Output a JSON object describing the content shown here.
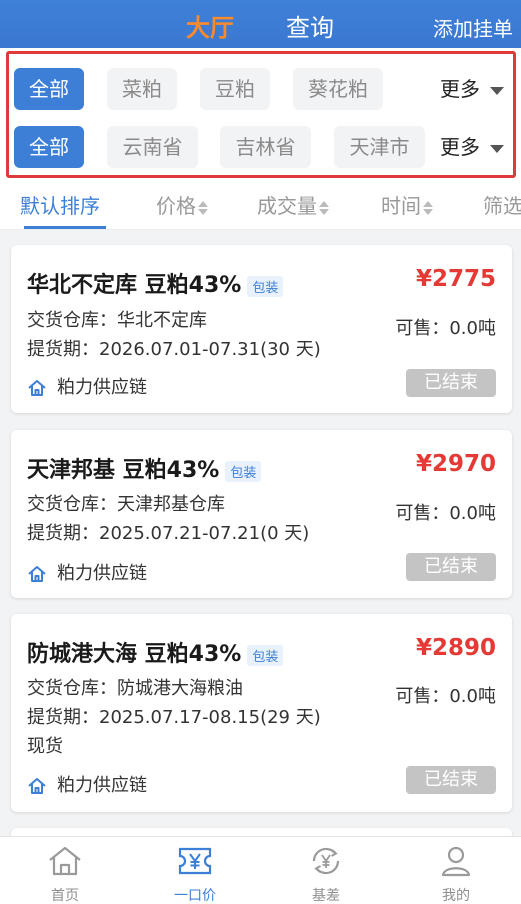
{
  "header": {
    "tab_hall": "大厅",
    "tab_query": "查询",
    "add_order": "添加挂单"
  },
  "filters": {
    "products": [
      "全部",
      "菜粕",
      "豆粕",
      "葵花粕"
    ],
    "regions": [
      "全部",
      "云南省",
      "吉林省",
      "天津市"
    ],
    "more_label": "更多"
  },
  "sort": {
    "default": "默认排序",
    "price": "价格",
    "volume": "成交量",
    "time": "时间",
    "filter": "筛选"
  },
  "cards": [
    {
      "title": "华北不定库   豆粕43%",
      "pack_tag": "包装",
      "price": "¥2775",
      "warehouse": "交货仓库：华北不定库",
      "pickup": "提货期：2026.07.01-07.31(30 天)",
      "extra": "",
      "available": "可售：0.0吨",
      "supplier": "粕力供应链",
      "status": "已结束"
    },
    {
      "title": "天津邦基 豆粕43%",
      "pack_tag": "包装",
      "price": "¥2970",
      "warehouse": "交货仓库：天津邦基仓库",
      "pickup": "提货期：2025.07.21-07.21(0 天)",
      "extra": "",
      "available": "可售：0.0吨",
      "supplier": "粕力供应链",
      "status": "已结束"
    },
    {
      "title": "防城港大海 豆粕43%",
      "pack_tag": "包装",
      "price": "¥2890",
      "warehouse": "交货仓库：防城港大海粮油",
      "pickup": "提货期：2025.07.17-08.15(29 天)",
      "extra": "现货",
      "available": "可售：0.0吨",
      "supplier": "粕力供应链",
      "status": "已结束"
    }
  ],
  "nav": {
    "home": "首页",
    "fixed_price": "一口价",
    "basis": "基差",
    "mine": "我的"
  },
  "colors": {
    "brand_blue": "#3d7fd6",
    "accent_orange": "#ff8a2a",
    "price_red": "#e53935",
    "highlight_box": "#e0393a"
  }
}
